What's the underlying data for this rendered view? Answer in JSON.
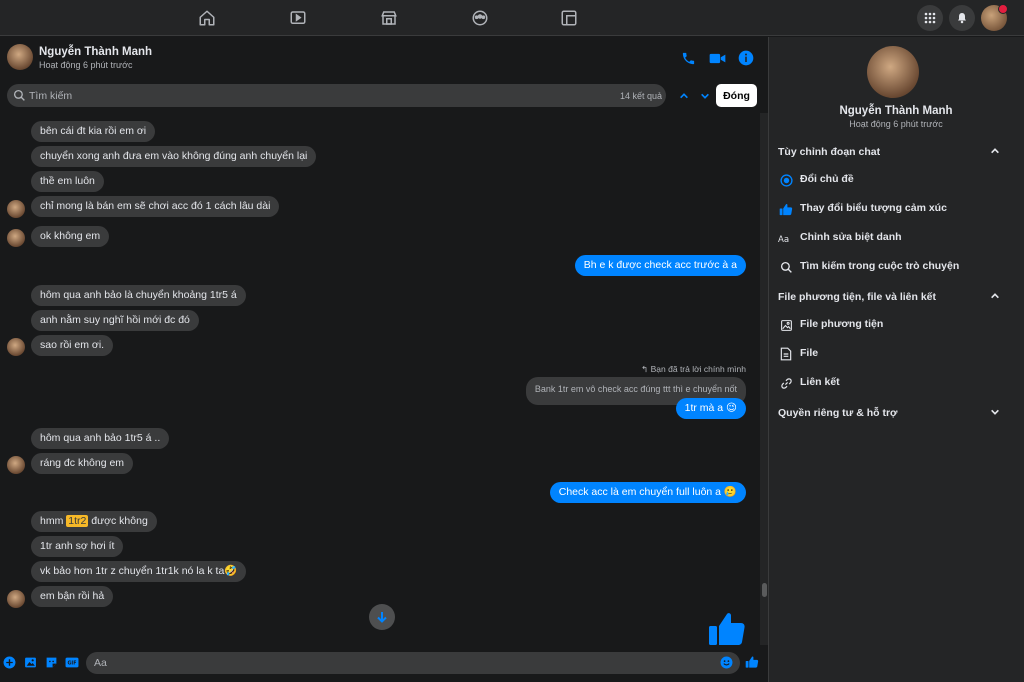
{
  "contact": {
    "name": "Nguyễn Thành Manh",
    "status": "Hoạt động 6 phút trước"
  },
  "search": {
    "placeholder": "Tìm kiếm",
    "result_count": "14 kết quả",
    "close_label": "Đóng"
  },
  "messages": {
    "m1": "bên cái đt kia rồi em ơi",
    "m2": "chuyển xong anh đưa em vào không đúng anh chuyển lại",
    "m3": "thề em luôn",
    "m4": "chỉ mong là bán em sẽ chơi acc đó 1 cách lâu dài",
    "m5": "ok không em",
    "m6": "Bh e k được check acc trước à a",
    "m7": "hôm qua anh bảo là chuyển khoảng 1tr5 á",
    "m8": "anh nằm suy nghĩ hồi mới đc đó",
    "m9": "sao rồi em ơi.",
    "reply_note": "Bạn đã trả lời chính mình",
    "m10_quoted": "Bank 1tr em vô check acc đúng ttt thì e chuyển nốt",
    "m10": "1tr mà a 😉",
    "m11": "hôm qua anh bảo 1tr5 á ..",
    "m12": "ráng đc không em",
    "m13": "Check acc là em chuyển full luôn a 🥲",
    "m14_pre": "hmm ",
    "m14_hl": "1tr2",
    "m14_post": " được không",
    "m15": "1tr anh sợ hơi ít",
    "m16": "vk bảo hơn 1tr z chuyển 1tr1k nó la k ta🤣",
    "m17": "em bận rồi hả"
  },
  "composer": {
    "placeholder": "Aa"
  },
  "right_panel": {
    "customize_title": "Tùy chỉnh đoạn chat",
    "change_theme": "Đổi chủ đề",
    "change_emoji": "Thay đổi biểu tượng cảm xúc",
    "edit_nicknames": "Chỉnh sửa biệt danh",
    "search_in_chat": "Tìm kiếm trong cuộc trò chuyện",
    "media_title": "File phương tiện, file và liên kết",
    "media_files": "File phương tiện",
    "files": "File",
    "links": "Liên kết",
    "privacy_title": "Quyền riêng tư & hỗ trợ"
  },
  "colors": {
    "accent": "#0084ff",
    "background": "#18191a",
    "panel": "#242526",
    "bubble_in": "#3a3b3c",
    "highlight": "#f7b928"
  },
  "icons": [
    "home-icon",
    "watch-icon",
    "marketplace-icon",
    "groups-icon",
    "gaming-icon",
    "menu-grid-icon",
    "bell-icon",
    "phone-icon",
    "video-icon",
    "info-icon",
    "search-icon",
    "chevron-up-icon",
    "chevron-down-icon",
    "arrow-down-icon",
    "like-icon",
    "plus-icon",
    "image-icon",
    "sticker-icon",
    "gif-icon",
    "emoji-icon"
  ]
}
